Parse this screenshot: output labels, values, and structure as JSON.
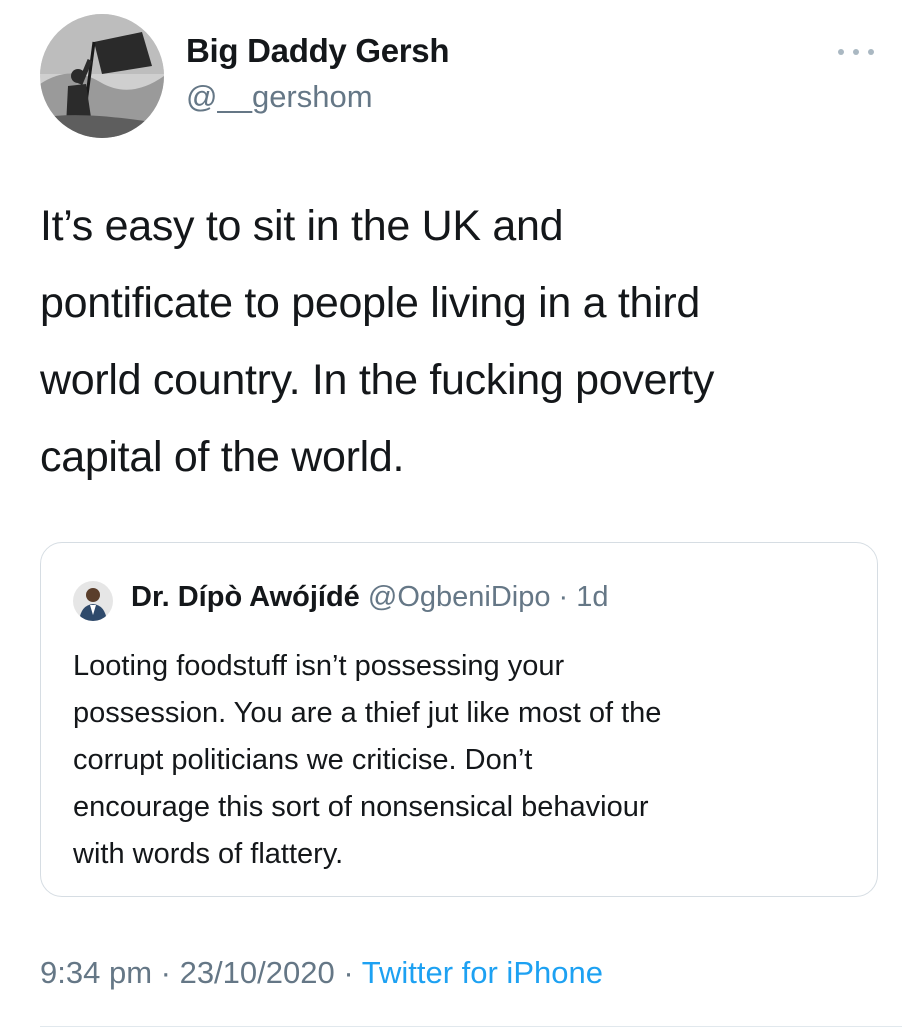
{
  "author": {
    "display_name": "Big Daddy Gersh",
    "handle": "@__gershom",
    "avatar_icon": "profile-photo-person-holding-flag-icon"
  },
  "more_icon": "more-options-icon",
  "tweet": {
    "lines": [
      "It’s easy to sit in the UK and",
      "pontificate to people living in a third",
      "world country. In the fucking poverty",
      "capital of the world."
    ]
  },
  "quoted_tweet": {
    "display_name": "Dr. Dípò Awójídé",
    "handle": "@OgbeniDipo",
    "separator": " · ",
    "time": "1d",
    "avatar_icon": "profile-photo-person-icon",
    "lines": [
      "Looting foodstuff isn’t possessing your",
      "possession. You are a thief jut like most of the",
      "corrupt politicians we criticise. Don’t",
      "encourage this sort of nonsensical behaviour",
      "with words of flattery."
    ]
  },
  "meta": {
    "time": "9:34 pm",
    "separator": " · ",
    "date": "23/10/2020",
    "source": "Twitter for iPhone"
  },
  "colors": {
    "text": "#14171a",
    "secondary": "#657786",
    "link": "#1da1f2",
    "border": "#d6dde3"
  }
}
